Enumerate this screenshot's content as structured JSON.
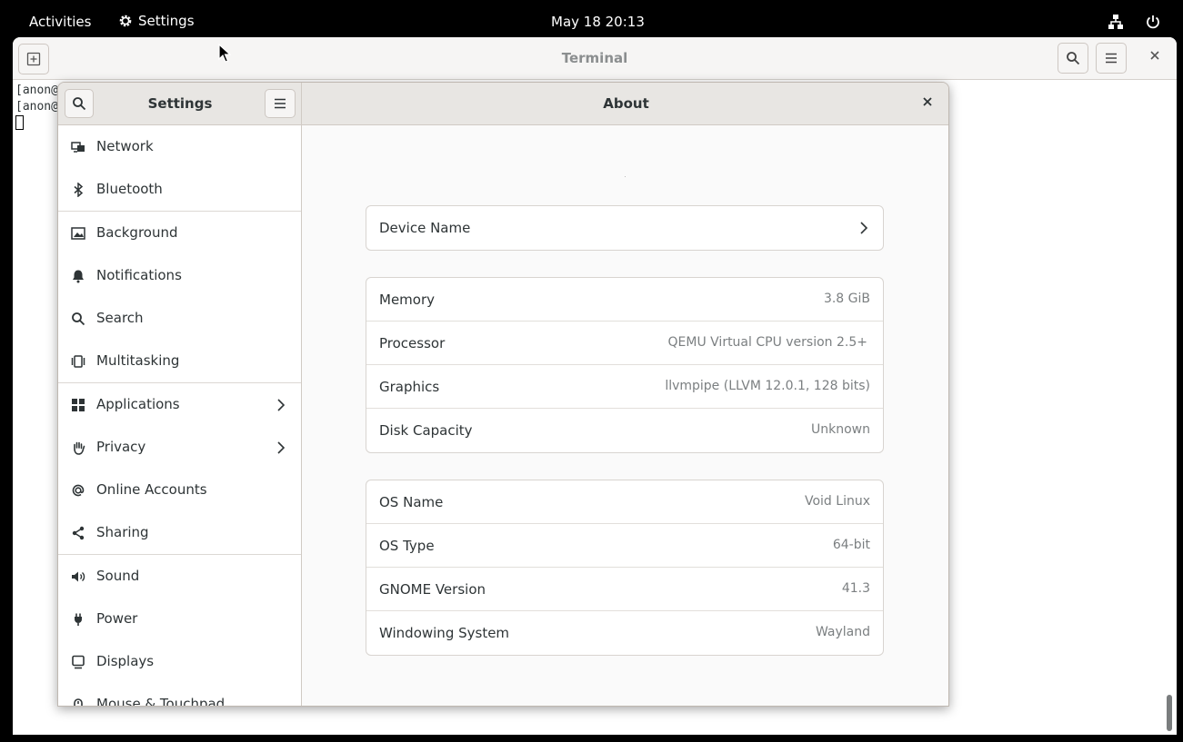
{
  "topbar": {
    "activities": "Activities",
    "app_name": "Settings",
    "clock": "May 18  20:13"
  },
  "terminal": {
    "title": "Terminal",
    "lines": [
      "[anon@",
      "[anon@"
    ]
  },
  "settings": {
    "sidebar_title": "Settings",
    "page_title": "About",
    "sidebar": {
      "items": [
        {
          "label": "Network",
          "icon": "network-icon"
        },
        {
          "label": "Bluetooth",
          "icon": "bluetooth-icon"
        },
        {
          "label": "Background",
          "icon": "background-icon"
        },
        {
          "label": "Notifications",
          "icon": "bell-icon"
        },
        {
          "label": "Search",
          "icon": "search-icon"
        },
        {
          "label": "Multitasking",
          "icon": "multitasking-icon"
        },
        {
          "label": "Applications",
          "icon": "applications-icon"
        },
        {
          "label": "Privacy",
          "icon": "hand-icon"
        },
        {
          "label": "Online Accounts",
          "icon": "at-icon"
        },
        {
          "label": "Sharing",
          "icon": "share-icon"
        },
        {
          "label": "Sound",
          "icon": "speaker-icon"
        },
        {
          "label": "Power",
          "icon": "power-plug-icon"
        },
        {
          "label": "Displays",
          "icon": "display-icon"
        },
        {
          "label": "Mouse & Touchpad",
          "icon": "mouse-icon"
        }
      ]
    },
    "about": {
      "device_name_label": "Device Name",
      "hardware": [
        {
          "label": "Memory",
          "value": "3.8 GiB"
        },
        {
          "label": "Processor",
          "value": "QEMU Virtual CPU version 2.5+"
        },
        {
          "label": "Graphics",
          "value": "llvmpipe (LLVM 12.0.1, 128 bits)"
        },
        {
          "label": "Disk Capacity",
          "value": "Unknown"
        }
      ],
      "software": [
        {
          "label": "OS Name",
          "value": "Void Linux"
        },
        {
          "label": "OS Type",
          "value": "64-bit"
        },
        {
          "label": "GNOME Version",
          "value": "41.3"
        },
        {
          "label": "Windowing System",
          "value": "Wayland"
        }
      ]
    }
  }
}
